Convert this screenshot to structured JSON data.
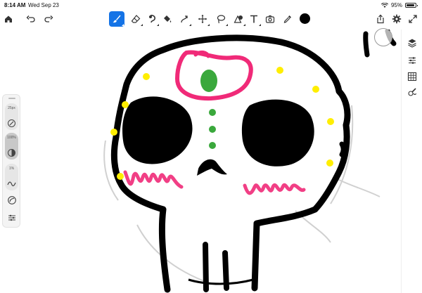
{
  "status": {
    "time": "8:14 AM",
    "date": "Wed Sep 23",
    "battery": "95%",
    "battery_level": 0.95
  },
  "toolbar": {
    "tools": [
      {
        "name": "home-icon",
        "active": false
      },
      {
        "name": "undo-icon",
        "active": false
      },
      {
        "name": "redo-icon",
        "active": false
      },
      {
        "name": "brush-tool-icon",
        "active": true
      },
      {
        "name": "eraser-tool-icon",
        "active": false
      },
      {
        "name": "smudge-tool-icon",
        "active": false
      },
      {
        "name": "fill-tool-icon",
        "active": false
      },
      {
        "name": "liquify-tool-icon",
        "active": false
      },
      {
        "name": "transform-tool-icon",
        "active": false
      },
      {
        "name": "lasso-tool-icon",
        "active": false
      },
      {
        "name": "shape-tool-icon",
        "active": false
      },
      {
        "name": "text-tool-icon",
        "active": false
      },
      {
        "name": "image-tool-icon",
        "active": false
      },
      {
        "name": "eyedropper-tool-icon",
        "active": false
      }
    ],
    "current_color": "#000000",
    "accent_color": "#1473e6"
  },
  "left_panel": {
    "size_label": "25px",
    "opacity_label": "100%",
    "smoothing_label": "1%"
  },
  "right_rail": [
    "share-icon",
    "settings-gear-icon",
    "fullscreen-icon",
    "layers-icon",
    "layer-properties-icon",
    "grid-icon",
    "brush-library-icon"
  ],
  "drawing": {
    "stroke_color": "#000000",
    "pink": "#f02a78",
    "green": "#3aa83c",
    "yellow": "#ffee00"
  }
}
